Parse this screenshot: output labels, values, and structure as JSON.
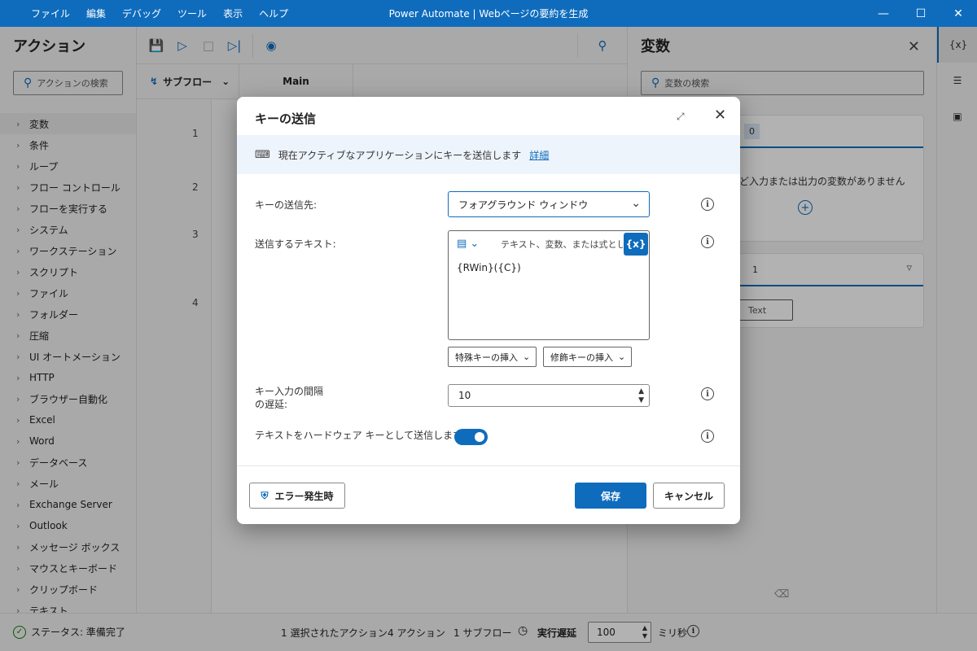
{
  "window": {
    "title": "Power Automate | Webページの要約を生成",
    "menu": [
      "ファイル",
      "編集",
      "デバッグ",
      "ツール",
      "表示",
      "ヘルプ"
    ]
  },
  "actions_pane": {
    "title": "アクション",
    "search_placeholder": "アクションの検索",
    "items": [
      "変数",
      "条件",
      "ループ",
      "フロー コントロール",
      "フローを実行する",
      "システム",
      "ワークステーション",
      "スクリプト",
      "ファイル",
      "フォルダー",
      "圧縮",
      "UI オートメーション",
      "HTTP",
      "ブラウザー自動化",
      "Excel",
      "Word",
      "データベース",
      "メール",
      "Exchange Server",
      "Outlook",
      "メッセージ ボックス",
      "マウスとキーボード",
      "クリップボード",
      "テキスト"
    ]
  },
  "designer": {
    "subflow_label": "サブフロー",
    "main_tab": "Main",
    "line_numbers": [
      "1",
      "2",
      "3",
      "4"
    ]
  },
  "variables_pane": {
    "title": "変数",
    "search_placeholder": "変数の検索",
    "input_output_count": "0",
    "empty_message": "ど入力または出力の変数がありません",
    "flow_vars_count": "1",
    "var_pill": "Text"
  },
  "rail": {
    "variables_icon_label": "{x}"
  },
  "status_bar": {
    "status": "ステータス: 準備完了",
    "selected_actions": "1 選択されたアクション",
    "actions_count": "4 アクション",
    "subflows_count": "1 サブフロー",
    "delay_label": "実行遅延",
    "delay_value": "100",
    "delay_unit": "ミリ秒"
  },
  "dialog": {
    "title": "キーの送信",
    "info_text": "現在アクティブなアプリケーションにキーを送信します",
    "info_link": "詳細",
    "send_to_label": "キーの送信先:",
    "send_to_value": "フォアグラウンド ウィンドウ",
    "text_label": "送信するテキスト:",
    "text_placeholder": "テキスト、変数、または式として入力",
    "text_value": "{RWin}({C})",
    "var_button": "{x}",
    "insert_special": "特殊キーの挿入",
    "insert_modifier": "修飾キーの挿入",
    "delay_label_line1": "キー入力の間隔",
    "delay_label_line2": "の遅延:",
    "delay_value": "10",
    "hardware_label": "テキストをハードウェア キーとして送信します:",
    "hardware_enabled": true,
    "error_button": "エラー発生時",
    "save_button": "保存",
    "cancel_button": "キャンセル"
  },
  "colors": {
    "accent": "#0f6cbd",
    "success": "#107c10"
  }
}
